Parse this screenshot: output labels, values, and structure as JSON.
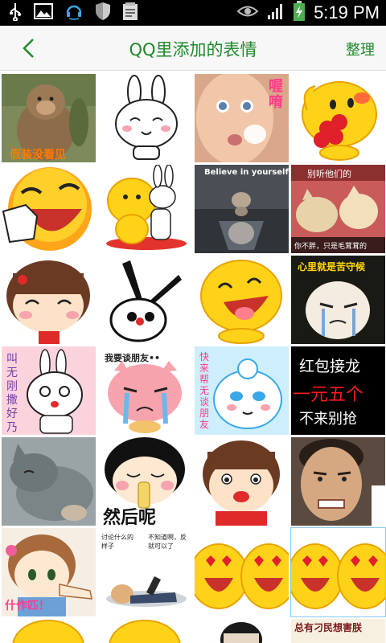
{
  "status_bar": {
    "time": "5:19 PM",
    "icons": [
      "usb-icon",
      "image-icon",
      "headset-icon",
      "shield-icon",
      "update-icon",
      "eye-icon",
      "signal-icon",
      "battery-charging-icon"
    ]
  },
  "app_bar": {
    "back_icon": "chevron-left-icon",
    "title": "QQ里添加的表情",
    "manage_label": "整理",
    "accent_color": "#1e8a2c"
  },
  "stickers": [
    {
      "name": "monkey",
      "caption": "假装没看见"
    },
    {
      "name": "rabbit-smile",
      "caption": ""
    },
    {
      "name": "baby-face",
      "caption": "喔唷"
    },
    {
      "name": "qq-flower",
      "caption": ""
    },
    {
      "name": "laughing-face",
      "caption": ""
    },
    {
      "name": "qq-hug-rabbit",
      "caption": ""
    },
    {
      "name": "kitten-tiger-reflection",
      "caption": "Believe in yourself"
    },
    {
      "name": "kittens-talking",
      "caption_top": "别听他们的",
      "caption_bottom": "你不胖，只是毛茸茸的"
    },
    {
      "name": "girl-smile",
      "caption": ""
    },
    {
      "name": "scissors-face",
      "caption": ""
    },
    {
      "name": "qq-laugh",
      "caption": ""
    },
    {
      "name": "crying-blob",
      "caption": "心里就是苦守候"
    },
    {
      "name": "rabbit-dazed",
      "caption": "叫无刚撒好乃"
    },
    {
      "name": "pig-crying",
      "caption": "我要谈朋友••"
    },
    {
      "name": "blob-shy",
      "caption": "快来帮无谈朋友"
    },
    {
      "name": "red-packet-text",
      "lines": [
        "红包接龙",
        "一元五个",
        "不来别抢"
      ]
    },
    {
      "name": "gray-cat",
      "caption": ""
    },
    {
      "name": "girl-bottle",
      "caption": "然后呢"
    },
    {
      "name": "girl-cheeks",
      "caption": ""
    },
    {
      "name": "man-face",
      "caption": ""
    },
    {
      "name": "anime-girl",
      "caption": "什作匹！"
    },
    {
      "name": "lying-person",
      "caption_left": "讨论什么的样子",
      "caption_right": "不知道啊，反就可以了"
    },
    {
      "name": "qq-hearts-a",
      "caption": ""
    },
    {
      "name": "qq-hearts-b",
      "caption": ""
    },
    {
      "name": "qq-partial-a",
      "caption": ""
    },
    {
      "name": "qq-partial-b",
      "caption": ""
    },
    {
      "name": "opera-face",
      "caption": ""
    },
    {
      "name": "partial-text",
      "caption": "总有刁民想害朕"
    }
  ]
}
